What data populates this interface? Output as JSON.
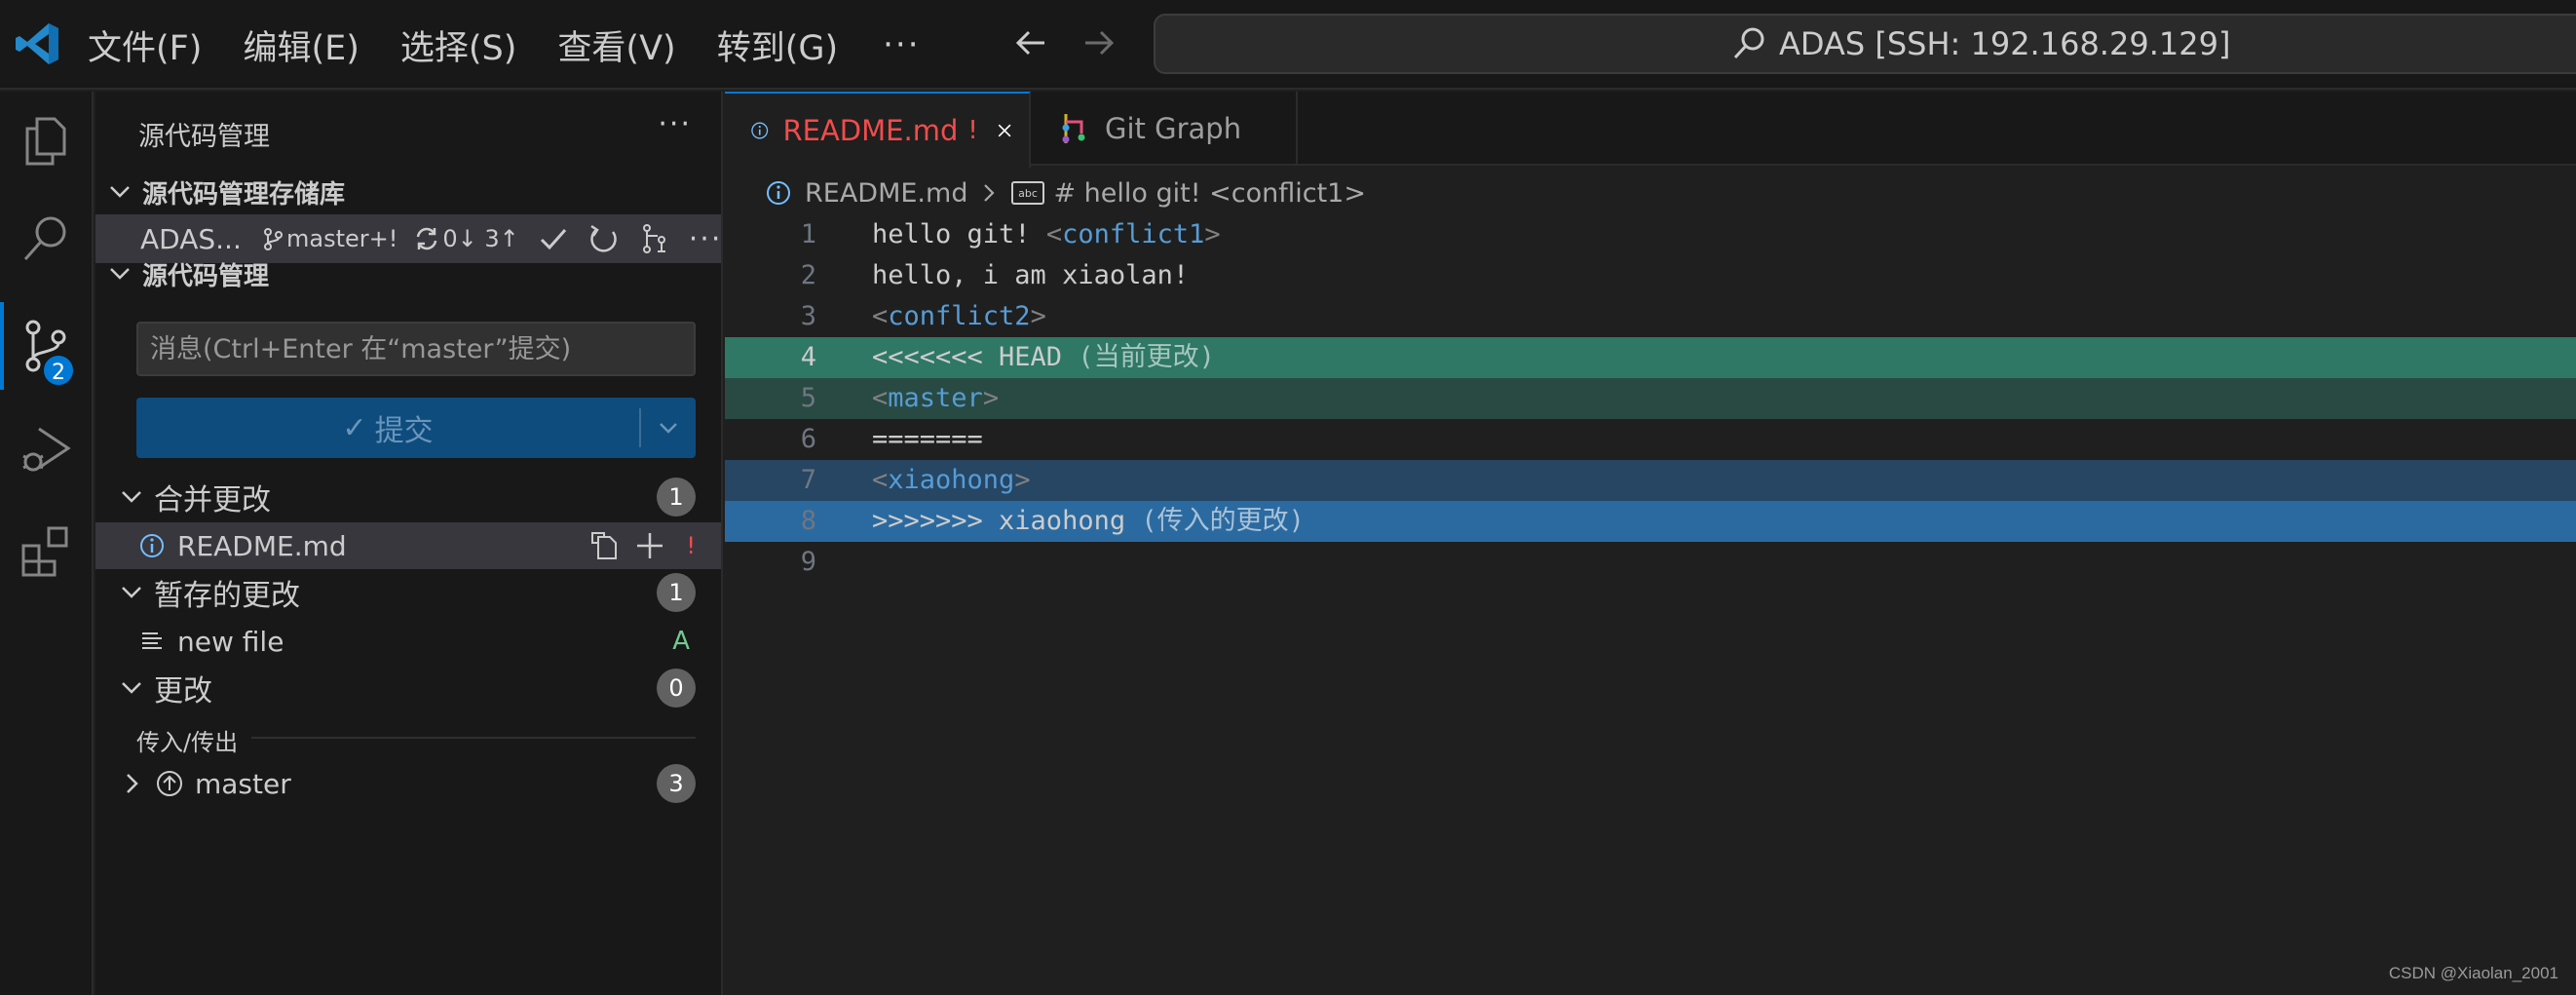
{
  "titlebar": {
    "menus": [
      "文件(F)",
      "编辑(E)",
      "选择(S)",
      "查看(V)",
      "转到(G)"
    ],
    "more": "···",
    "command_center": "ADAS [SSH: 192.168.29.129]"
  },
  "activity": {
    "scm_badge": "2"
  },
  "sidebar": {
    "title": "源代码管理",
    "more": "···",
    "repos_section": "源代码管理存储库",
    "repo": {
      "name": "ADAS...",
      "branch": "master+!",
      "sync": "0↓ 3↑"
    },
    "scm_section": "源代码管理",
    "message_placeholder": "消息(Ctrl+Enter 在“master”提交)",
    "commit_label": "提交",
    "commit_check": "✓",
    "groups": {
      "merge": {
        "label": "合并更改",
        "count": "1"
      },
      "staged": {
        "label": "暂存的更改",
        "count": "1"
      },
      "changes": {
        "label": "更改",
        "count": "0"
      }
    },
    "merge_file": {
      "name": "README.md",
      "status": "!"
    },
    "staged_file": {
      "name": "new file",
      "status": "A"
    },
    "incoming_outgoing": {
      "label": "传入/传出",
      "branch": "master",
      "count": "3"
    }
  },
  "tabs": [
    {
      "label": "README.md",
      "mark": "!"
    },
    {
      "label": "Git Graph"
    }
  ],
  "breadcrumb": {
    "file": "README.md",
    "symbol": "# hello git! <conflict1>"
  },
  "editor": {
    "line_numbers": [
      "1",
      "2",
      "3",
      "4",
      "5",
      "6",
      "7",
      "8",
      "9"
    ],
    "lines": {
      "l1_text": "hello git! ",
      "l1_lt": "<",
      "l1_tag": "conflict1",
      "l1_gt": ">",
      "l2_text": "hello, i am xiaolan!",
      "l3_lt": "<",
      "l3_tag": "conflict2",
      "l3_gt": ">",
      "l4_text": "<<<<<<< HEAD ",
      "l4_hint": "(当前更改)",
      "l5_lt": "<",
      "l5_tag": "master",
      "l5_gt": ">",
      "l6_text": "=======",
      "l7_lt": "<",
      "l7_tag": "xiaohong",
      "l7_gt": ">",
      "l8_text": ">>>>>>> xiaohong ",
      "l8_hint": "(传入的更改)"
    }
  },
  "watermark": "CSDN @Xiaolan_2001",
  "colors": {
    "accent": "#0078d4",
    "current_change": "#2e7865",
    "incoming_change": "#2b6aa0",
    "conflict_red": "#f14c4c",
    "added_green": "#73c991"
  }
}
